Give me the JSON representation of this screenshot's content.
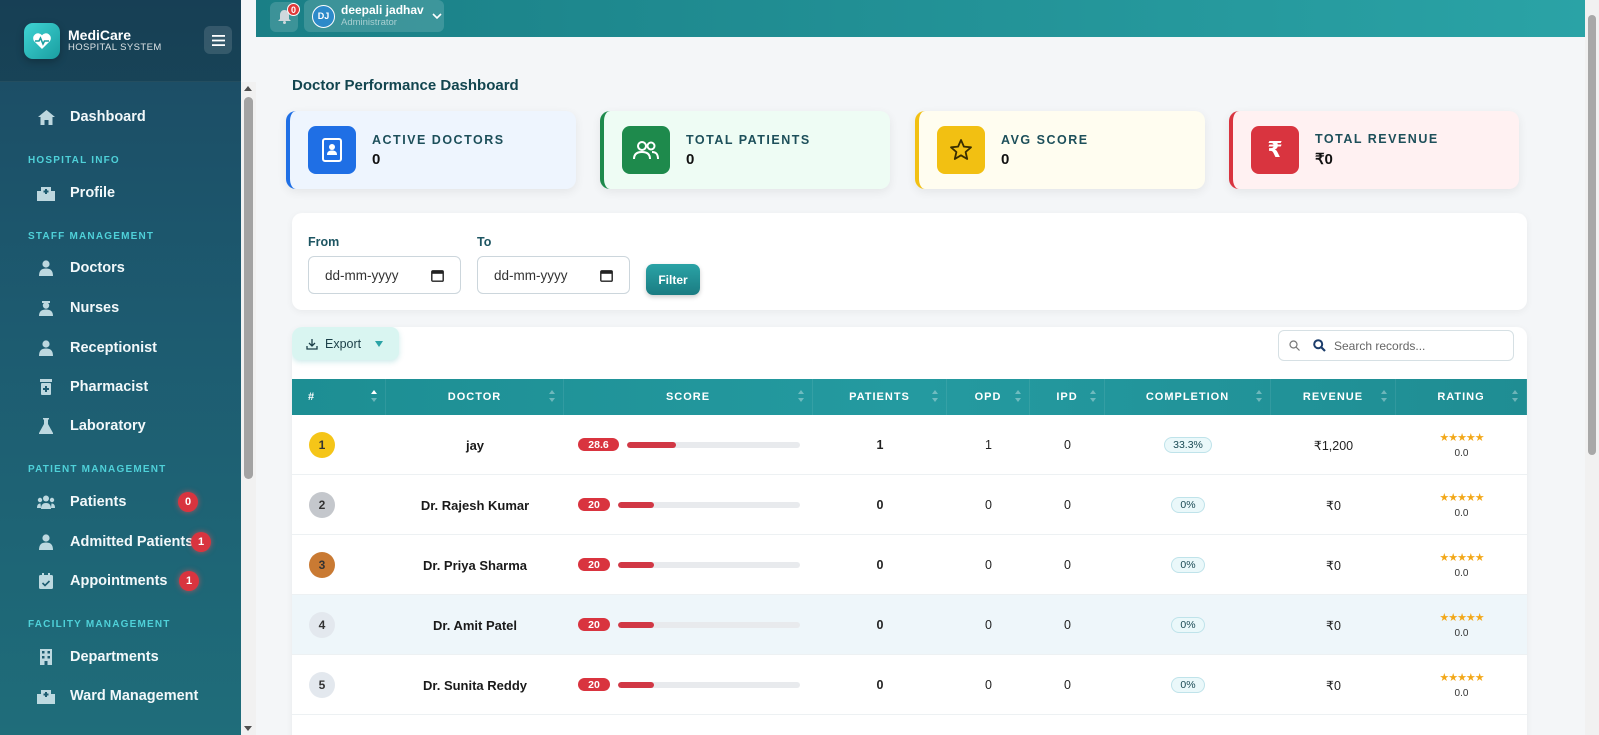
{
  "app": {
    "name": "MediCare",
    "subtitle": "HOSPITAL SYSTEM"
  },
  "topbar": {
    "notification_count": "0",
    "user_initials": "DJ",
    "user_name": "deepali jadhav",
    "user_role": "Administrator"
  },
  "sidebar": {
    "dashboard": "Dashboard",
    "sections": {
      "hospital_info": "HOSPITAL INFO",
      "staff_management": "STAFF MANAGEMENT",
      "patient_management": "PATIENT MANAGEMENT",
      "facility_management": "FACILITY MANAGEMENT"
    },
    "items": {
      "profile": "Profile",
      "doctors": "Doctors",
      "nurses": "Nurses",
      "receptionist": "Receptionist",
      "pharmacist": "Pharmacist",
      "laboratory": "Laboratory",
      "patients": "Patients",
      "admitted_patients": "Admitted Patients",
      "appointments": "Appointments",
      "departments": "Departments",
      "ward_management": "Ward Management"
    },
    "badges": {
      "patients": "0",
      "admitted_patients": "1",
      "appointments": "1"
    }
  },
  "page": {
    "title": "Doctor Performance Dashboard"
  },
  "stats": [
    {
      "label": "ACTIVE DOCTORS",
      "value": "0",
      "icon": "doctor-id-icon",
      "color": "#1f6fe5"
    },
    {
      "label": "TOTAL PATIENTS",
      "value": "0",
      "icon": "users-icon",
      "color": "#1e8a4c"
    },
    {
      "label": "AVG SCORE",
      "value": "0",
      "icon": "star-icon",
      "color": "#f2c012"
    },
    {
      "label": "TOTAL REVENUE",
      "value": "₹0",
      "icon": "rupee-icon",
      "color": "#d9343f"
    }
  ],
  "filters": {
    "from_label": "From",
    "to_label": "To",
    "from_placeholder": "dd-mm-yyyy",
    "to_placeholder": "dd-mm-yyyy",
    "filter_button": "Filter"
  },
  "table": {
    "export_label": "Export",
    "search_placeholder": "Search records...",
    "columns": [
      "#",
      "DOCTOR",
      "SCORE",
      "PATIENTS",
      "OPD",
      "IPD",
      "COMPLETION",
      "REVENUE",
      "RATING"
    ],
    "rows": [
      {
        "rank": "1",
        "doctor": "jay",
        "score": "28.6",
        "score_fraction": 0.286,
        "patients": "1",
        "opd": "1",
        "ipd": "0",
        "completion": "33.3%",
        "revenue": "₹1,200",
        "rating": "0.0",
        "rank_color": "#f5c518"
      },
      {
        "rank": "2",
        "doctor": "Dr. Rajesh Kumar",
        "score": "20",
        "score_fraction": 0.2,
        "patients": "0",
        "opd": "0",
        "ipd": "0",
        "completion": "0%",
        "revenue": "₹0",
        "rating": "0.0",
        "rank_color": "#c4c7cc"
      },
      {
        "rank": "3",
        "doctor": "Dr. Priya Sharma",
        "score": "20",
        "score_fraction": 0.2,
        "patients": "0",
        "opd": "0",
        "ipd": "0",
        "completion": "0%",
        "revenue": "₹0",
        "rating": "0.0",
        "rank_color": "#c97a33"
      },
      {
        "rank": "4",
        "doctor": "Dr. Amit Patel",
        "score": "20",
        "score_fraction": 0.2,
        "patients": "0",
        "opd": "0",
        "ipd": "0",
        "completion": "0%",
        "revenue": "₹0",
        "rating": "0.0",
        "rank_color": "#e3e8ee"
      },
      {
        "rank": "5",
        "doctor": "Dr. Sunita Reddy",
        "score": "20",
        "score_fraction": 0.2,
        "patients": "0",
        "opd": "0",
        "ipd": "0",
        "completion": "0%",
        "revenue": "₹0",
        "rating": "0.0",
        "rank_color": "#e3e8ee"
      }
    ],
    "stars": "★★★★★"
  }
}
